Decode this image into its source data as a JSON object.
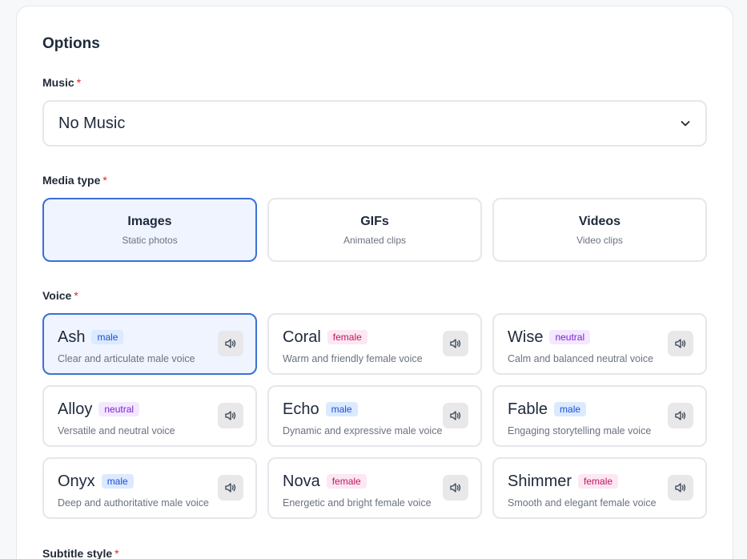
{
  "section_title": "Options",
  "required_mark": "*",
  "music": {
    "label": "Music",
    "value": "No Music"
  },
  "media_type": {
    "label": "Media type",
    "options": [
      {
        "title": "Images",
        "subtitle": "Static photos",
        "selected": true
      },
      {
        "title": "GIFs",
        "subtitle": "Animated clips",
        "selected": false
      },
      {
        "title": "Videos",
        "subtitle": "Video clips",
        "selected": false
      }
    ]
  },
  "voice": {
    "label": "Voice",
    "options": [
      {
        "name": "Ash",
        "gender": "male",
        "description": "Clear and articulate male voice",
        "selected": true
      },
      {
        "name": "Coral",
        "gender": "female",
        "description": "Warm and friendly female voice",
        "selected": false
      },
      {
        "name": "Wise",
        "gender": "neutral",
        "description": "Calm and balanced neutral voice",
        "selected": false
      },
      {
        "name": "Alloy",
        "gender": "neutral",
        "description": "Versatile and neutral voice",
        "selected": false
      },
      {
        "name": "Echo",
        "gender": "male",
        "description": "Dynamic and expressive male voice",
        "selected": false
      },
      {
        "name": "Fable",
        "gender": "male",
        "description": "Engaging storytelling male voice",
        "selected": false
      },
      {
        "name": "Onyx",
        "gender": "male",
        "description": "Deep and authoritative male voice",
        "selected": false
      },
      {
        "name": "Nova",
        "gender": "female",
        "description": "Energetic and bright female voice",
        "selected": false
      },
      {
        "name": "Shimmer",
        "gender": "female",
        "description": "Smooth and elegant female voice",
        "selected": false
      }
    ]
  },
  "subtitle_style": {
    "label": "Subtitle style"
  },
  "icons": {
    "dropdown": "chevron-down-icon",
    "play": "speaker-icon"
  },
  "colors": {
    "accent": "#3b6fd6",
    "selected_bg": "#eff4ff",
    "required": "#dc2626"
  }
}
